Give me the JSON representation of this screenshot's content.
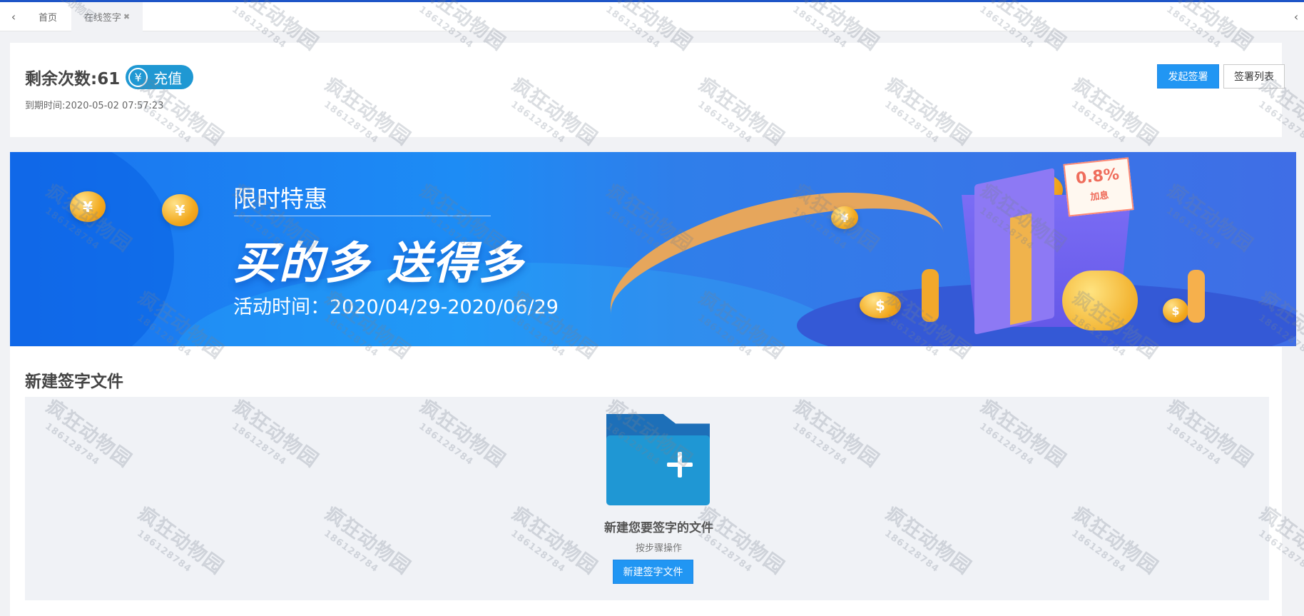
{
  "tabs": {
    "nav_left": "‹",
    "nav_right": "‹",
    "home": "首页",
    "active": "在线签字",
    "close": "✖"
  },
  "account": {
    "remaining": "剩余次数:61",
    "recharge": "充值",
    "yen_symbol": "¥",
    "expire": "到期时间:2020-05-02 07:57:23",
    "launch_button": "发起签署",
    "list_button": "签署列表"
  },
  "banner": {
    "title": "限时特惠",
    "slogan": "买的多 送得多",
    "time": "活动时间：2020/04/29-2020/06/29",
    "coin_symbol": "¥",
    "dollar_symbol": "$",
    "coupon_value": "0.8%",
    "coupon_label": "加息"
  },
  "new_file": {
    "section_title": "新建签字文件",
    "upload_title": "新建您要签字的文件",
    "upload_desc": "按步骤操作",
    "button": "新建签字文件"
  },
  "watermark": {
    "text": "疯狂动物园",
    "number": "186128784"
  },
  "colors": {
    "primary": "#2196f3",
    "folder": "#1f97d4",
    "banner_blue": "#1a74ef"
  }
}
